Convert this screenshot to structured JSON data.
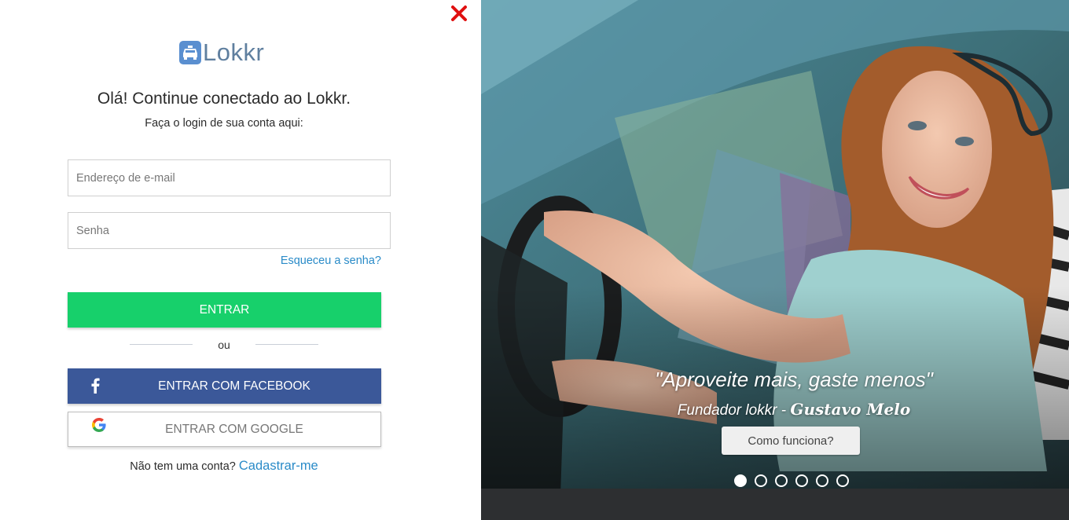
{
  "brand": {
    "name": "Lokkr",
    "color": "#5a8fd0"
  },
  "login": {
    "heading": "Olá! Continue conectado ao Lokkr.",
    "subheading": "Faça o login de sua conta aqui:",
    "email_placeholder": "Endereço de e-mail",
    "password_placeholder": "Senha",
    "forgot_label": "Esqueceu a senha?",
    "enter_label": "ENTRAR",
    "or_label": "ou",
    "facebook_label": "ENTRAR COM FACEBOOK",
    "google_label": "ENTRAR COM GOOGLE",
    "signup_prompt": "Não tem uma conta?",
    "signup_link": "Cadastrar-me"
  },
  "hero": {
    "quote": "\"Aproveite mais, gaste menos\"",
    "author_prefix": "Fundador lokkr - ",
    "author_name": "Gustavo Melo",
    "cta_label": "Como funciona?",
    "slides": 6,
    "active_slide": 1
  },
  "colors": {
    "enter": "#17d06b",
    "facebook": "#3b5899",
    "link": "#2a8bc8",
    "close": "#e01010"
  },
  "icons": [
    "close-icon",
    "taxi-icon",
    "facebook-icon",
    "google-icon"
  ]
}
